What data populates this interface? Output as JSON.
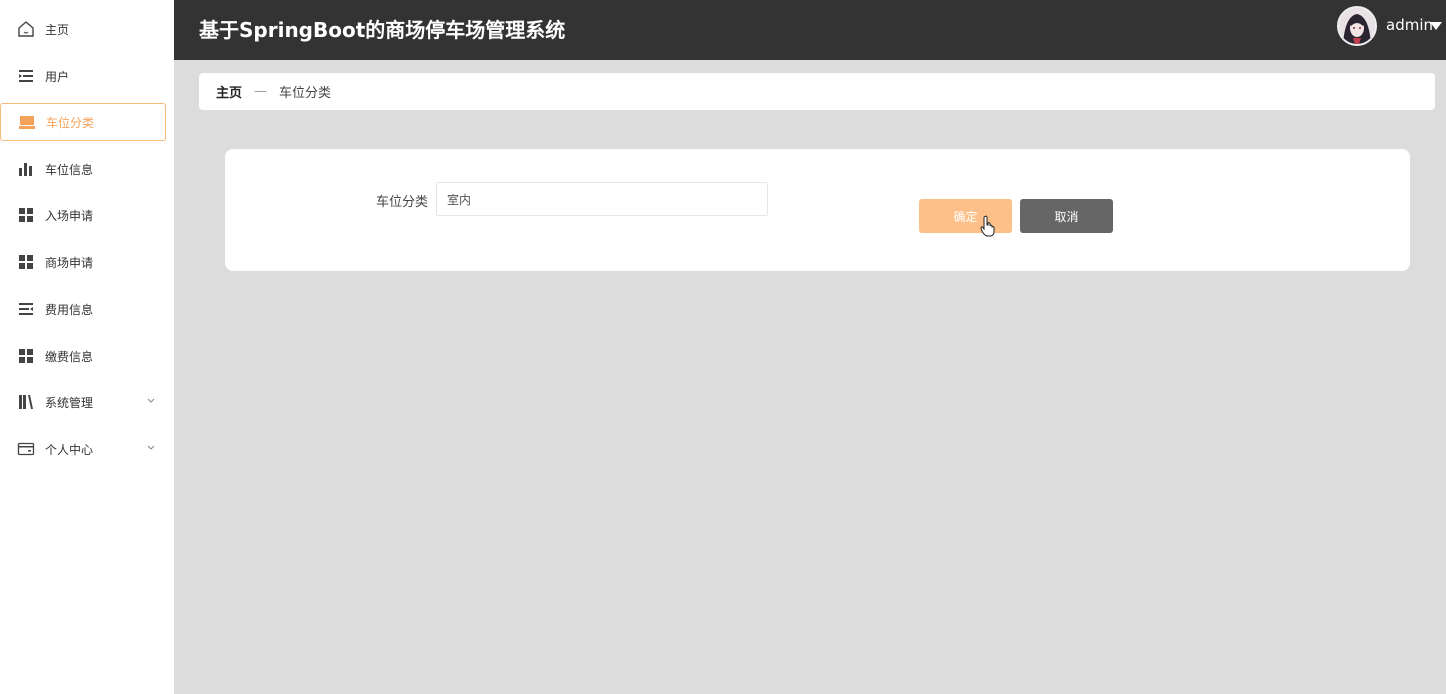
{
  "header": {
    "title": "基于SpringBoot的商场停车场管理系统",
    "username": "admin"
  },
  "sidebar": {
    "items": [
      {
        "label": "主页",
        "icon": "home-icon"
      },
      {
        "label": "用户",
        "icon": "list-indent-icon"
      },
      {
        "label": "车位分类",
        "icon": "box-icon",
        "active": true
      },
      {
        "label": "车位信息",
        "icon": "bar-chart-icon"
      },
      {
        "label": "入场申请",
        "icon": "grid-icon"
      },
      {
        "label": "商场申请",
        "icon": "grid-icon"
      },
      {
        "label": "费用信息",
        "icon": "list-indent-icon"
      },
      {
        "label": "缴费信息",
        "icon": "grid-icon"
      },
      {
        "label": "系统管理",
        "icon": "books-icon",
        "expandable": true
      },
      {
        "label": "个人中心",
        "icon": "card-icon",
        "expandable": true
      }
    ]
  },
  "breadcrumb": {
    "home": "主页",
    "separator": "—",
    "current": "车位分类"
  },
  "form": {
    "field_label": "车位分类",
    "field_value": "室内",
    "confirm_label": "确定",
    "cancel_label": "取消"
  },
  "colors": {
    "header_bg": "#333333",
    "accent": "#f5a35b",
    "confirm_bg": "#fcc088",
    "cancel_bg": "#666666",
    "page_bg": "#dcdcdc"
  }
}
